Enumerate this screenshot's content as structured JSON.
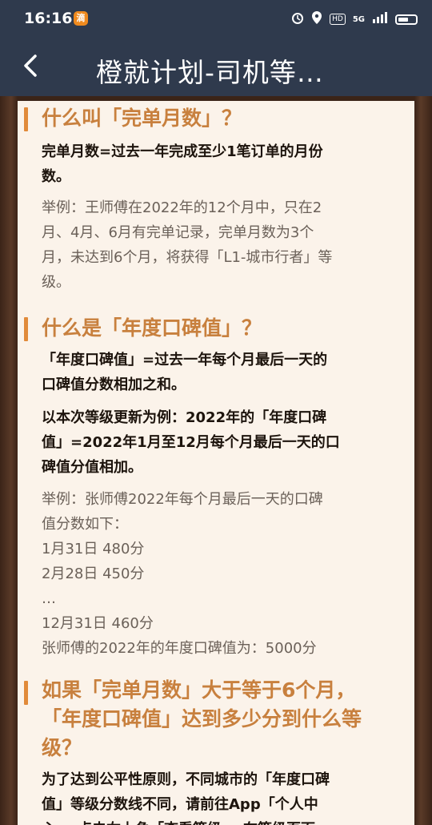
{
  "status_bar": {
    "time": "16:16",
    "app_icon": "滴",
    "hd": "HD",
    "net": "5G"
  },
  "header": {
    "title": "橙就计划-司机等…"
  },
  "sections": [
    {
      "title": "什么叫「完单月数」？",
      "paragraphs": [
        {
          "lines": [
            "完单月数=过去一年完成至少1笔订单的月份",
            "数。"
          ]
        },
        {
          "lines": [
            "举例：王师傅在2022年的12个月中，只在2",
            "月、4月、6月有完单记录，完单月数为3个",
            "月，未达到6个月，将获得「L1-城市行者」等",
            "级。"
          ]
        }
      ]
    },
    {
      "title": "什么是「年度口碑值」？",
      "paragraphs": [
        {
          "lines": [
            "「年度口碑值」=过去一年每个月最后一天的",
            "口碑值分数相加之和。"
          ]
        },
        {
          "lines": [
            "以本次等级更新为例：2022年的「年度口碑",
            "值」=2022年1月至12月每个月最后一天的口",
            "碑值分值相加。"
          ]
        },
        {
          "lines": [
            "举例：张师傅2022年每个月最后一天的口碑",
            "值分数如下：",
            "1月31日    480分",
            "2月28日    450分",
            "…",
            "12月31日    460分",
            "张师傅的2022年的年度口碑值为：5000分"
          ]
        }
      ]
    },
    {
      "title_lines": [
        "如果「完单月数」大于等于6个月，",
        "「年度口碑值」达到多少分到什么等",
        "级？"
      ],
      "paragraphs": [
        {
          "lines": [
            "为了达到公平性原则，不同城市的「年度口碑",
            "值」等级分数线不同，请前往App「个人中",
            "心」，点击右上角「查看等级」，在等级页面"
          ]
        }
      ]
    }
  ]
}
